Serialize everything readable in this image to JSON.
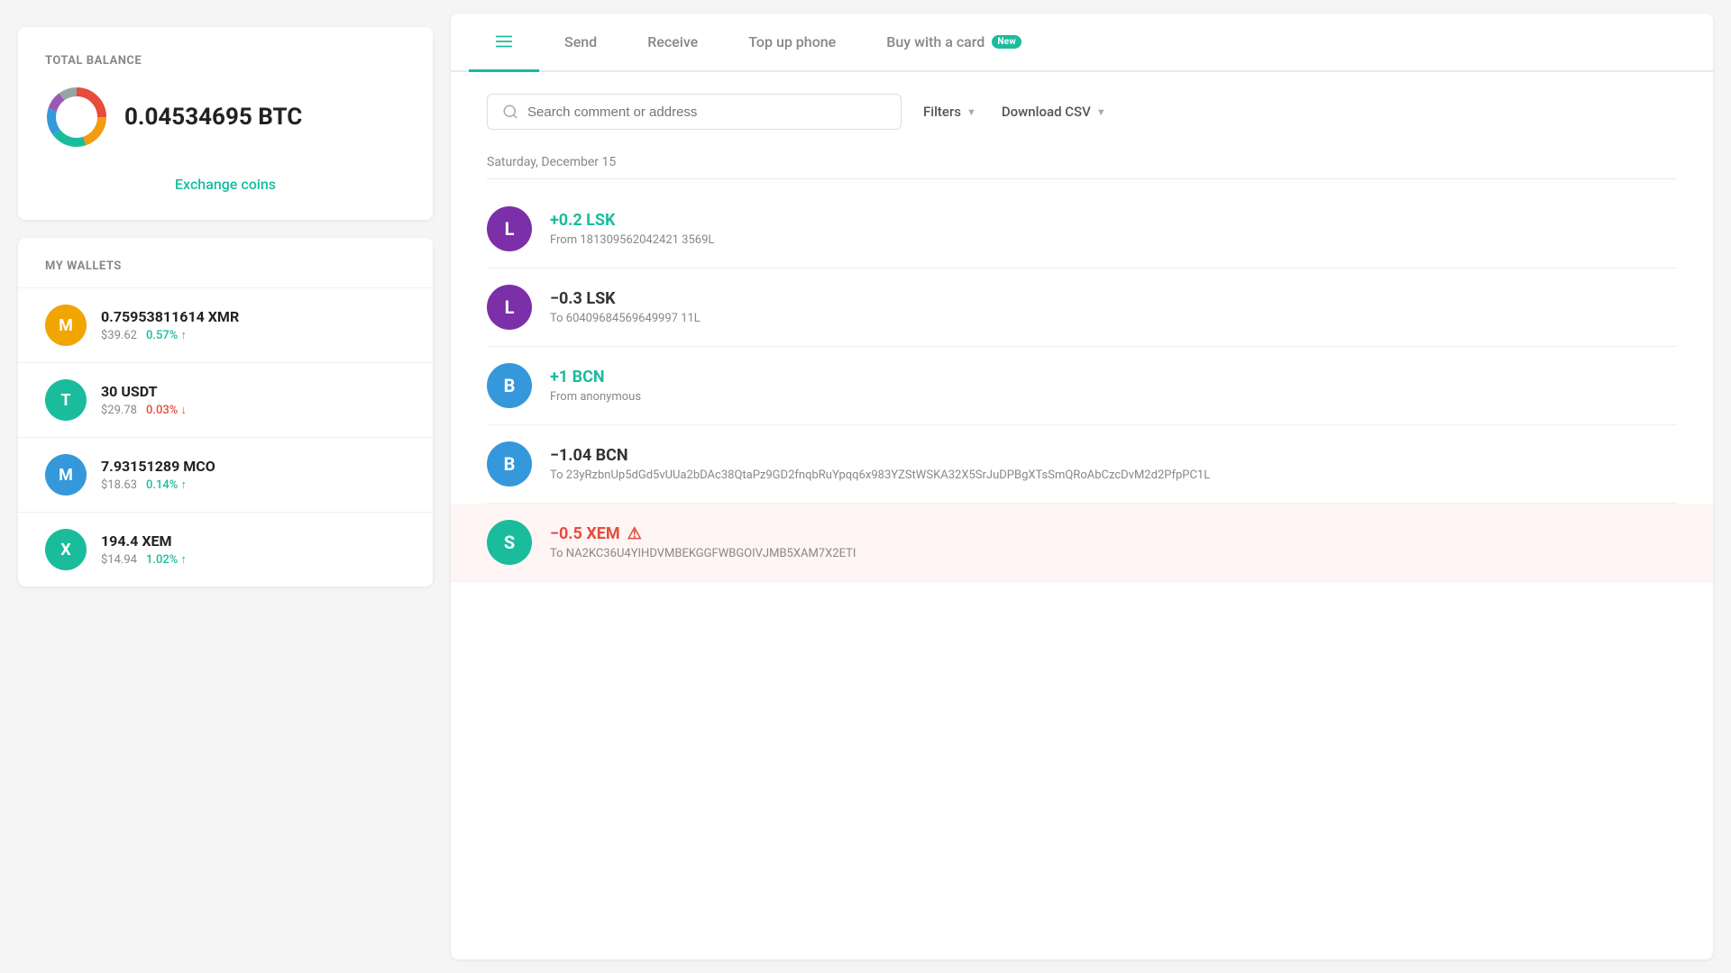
{
  "left": {
    "total_balance_label": "TOTAL BALANCE",
    "balance_amount": "0.04534695 BTC",
    "exchange_link": "Exchange coins",
    "wallets_label": "MY WALLETS",
    "wallets": [
      {
        "id": "xmr",
        "symbol": "M",
        "amount": "0.75953811614 XMR",
        "usd": "$39.62",
        "change": "0.57% ↑",
        "change_dir": "up",
        "bg": "#f0a500"
      },
      {
        "id": "usdt",
        "symbol": "T",
        "amount": "30 USDT",
        "usd": "$29.78",
        "change": "0.03% ↓",
        "change_dir": "down",
        "bg": "#1abc9c"
      },
      {
        "id": "mco",
        "symbol": "M",
        "amount": "7.93151289 MCO",
        "usd": "$18.63",
        "change": "0.14% ↑",
        "change_dir": "up",
        "bg": "#3498db"
      },
      {
        "id": "xem",
        "symbol": "X",
        "amount": "194.4 XEM",
        "usd": "$14.94",
        "change": "1.02% ↑",
        "change_dir": "up",
        "bg": "#1abc9c"
      }
    ]
  },
  "right": {
    "tabs": [
      {
        "id": "transactions",
        "label": "",
        "icon": "list",
        "active": true
      },
      {
        "id": "send",
        "label": "Send",
        "icon": null,
        "active": false
      },
      {
        "id": "receive",
        "label": "Receive",
        "icon": null,
        "active": false
      },
      {
        "id": "topup",
        "label": "Top up phone",
        "icon": null,
        "active": false,
        "badge": null
      },
      {
        "id": "buywithcard",
        "label": "Buy with a card",
        "icon": null,
        "active": false,
        "badge": "New"
      }
    ],
    "search_placeholder": "Search comment or address",
    "filters_label": "Filters",
    "csv_label": "Download CSV",
    "date_group": "Saturday, December 15",
    "transactions": [
      {
        "id": "tx1",
        "coin": "LSK",
        "coin_letter": "L",
        "coin_bg": "#7b2fa8",
        "amount": "+0.2 LSK",
        "direction": "positive",
        "address_label": "From 18130956204242135 69L",
        "address": "From 181309562042421 3569L",
        "error": false
      },
      {
        "id": "tx2",
        "coin": "LSK",
        "coin_letter": "L",
        "coin_bg": "#7b2fa8",
        "amount": "−0.3 LSK",
        "direction": "negative",
        "address": "To 60409684569649997 11L",
        "error": false
      },
      {
        "id": "tx3",
        "coin": "BCN",
        "coin_letter": "B",
        "coin_bg": "#3498db",
        "amount": "+1 BCN",
        "direction": "positive",
        "address": "From anonymous",
        "error": false
      },
      {
        "id": "tx4",
        "coin": "BCN",
        "coin_letter": "B",
        "coin_bg": "#3498db",
        "amount": "−1.04 BCN",
        "direction": "negative",
        "address": "To 23yRzbnUp5dGd5vUUa2bDAc38QtaPz9GD2fnqbRuYpqq6x983YZStWSKA32X5SrJuDPBgXTsSmQRoAbCzcDvM2d2PfpPC1L",
        "error": false
      },
      {
        "id": "tx5",
        "coin": "XEM",
        "coin_letter": "S",
        "coin_bg": "#1abc9c",
        "amount": "−0.5 XEM",
        "direction": "error",
        "address": "To NA2KC36U4YIHDVMBEKGGFWBGOIVJMB5XAM7X2ETI",
        "error": true
      }
    ]
  },
  "donut": {
    "segments": [
      {
        "color": "#e74c3c",
        "value": 25
      },
      {
        "color": "#f39c12",
        "value": 20
      },
      {
        "color": "#1abc9c",
        "value": 20
      },
      {
        "color": "#3498db",
        "value": 15
      },
      {
        "color": "#9b59b6",
        "value": 10
      },
      {
        "color": "#95a5a6",
        "value": 10
      }
    ]
  }
}
